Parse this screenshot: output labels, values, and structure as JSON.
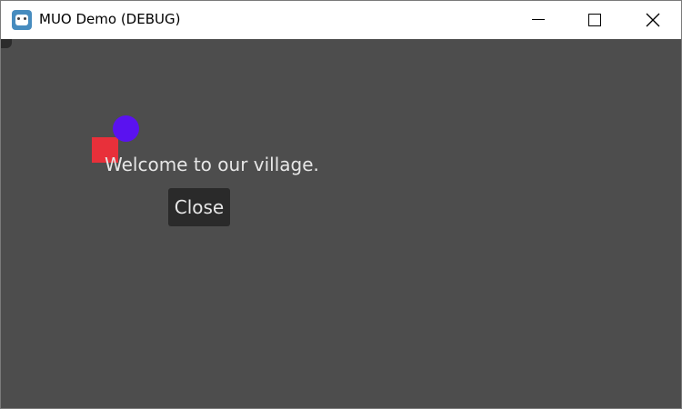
{
  "window": {
    "title": "MUO Demo (DEBUG)",
    "app_icon": "godot-icon",
    "controls": {
      "minimize_icon": "minimize-icon",
      "maximize_icon": "maximize-icon",
      "close_icon": "close-icon"
    }
  },
  "game": {
    "background_color": "#4d4d4d",
    "player_square_color": "#e8303a",
    "npc_circle_color": "#5a12f0",
    "dialog": {
      "message": "Welcome to our village.",
      "close_label": "Close"
    }
  }
}
